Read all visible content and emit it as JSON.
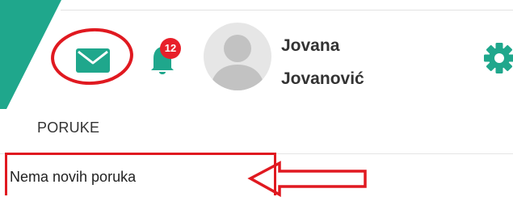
{
  "header": {
    "mail_icon": "envelope-icon",
    "bell_icon": "bell-icon",
    "notification_count": "12",
    "user": {
      "first_name": "Jovana",
      "last_name": "Jovanović",
      "avatar_icon": "default-user-avatar"
    },
    "settings_icon": "gear-icon"
  },
  "messages": {
    "title": "PORUKE",
    "empty_text": "Nema novih poruka"
  },
  "colors": {
    "accent_teal": "#1fa78c",
    "badge_red": "#e8202a",
    "annotation_red": "#e01920",
    "avatar_bg": "#e6e6e6",
    "avatar_silhouette": "#c2c2c2"
  }
}
